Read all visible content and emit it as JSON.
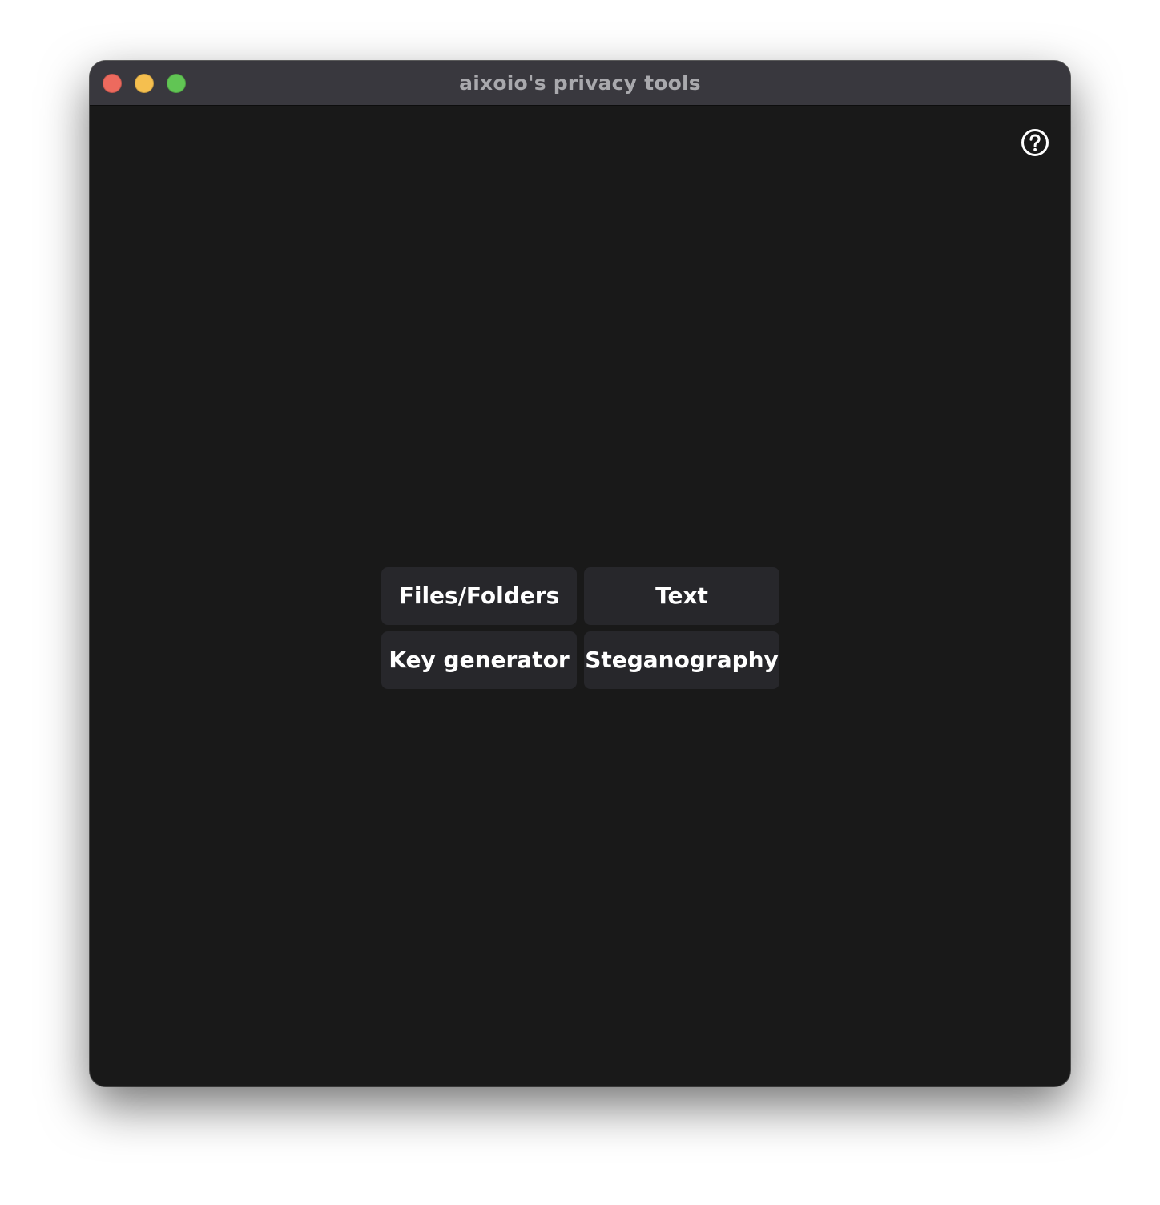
{
  "window": {
    "title": "aixoio's privacy tools"
  },
  "help": {
    "icon": "question-circle-icon"
  },
  "menu": {
    "files_label": "Files/Folders",
    "text_label": "Text",
    "keygen_label": "Key generator",
    "stego_label": "Steganography"
  },
  "colors": {
    "window_background": "#191919",
    "titlebar_background": "#39383e",
    "button_background": "#27272b",
    "button_text": "#ffffff",
    "close": "#ed6a5e",
    "minimize": "#f5bf4f",
    "maximize": "#61c554"
  }
}
